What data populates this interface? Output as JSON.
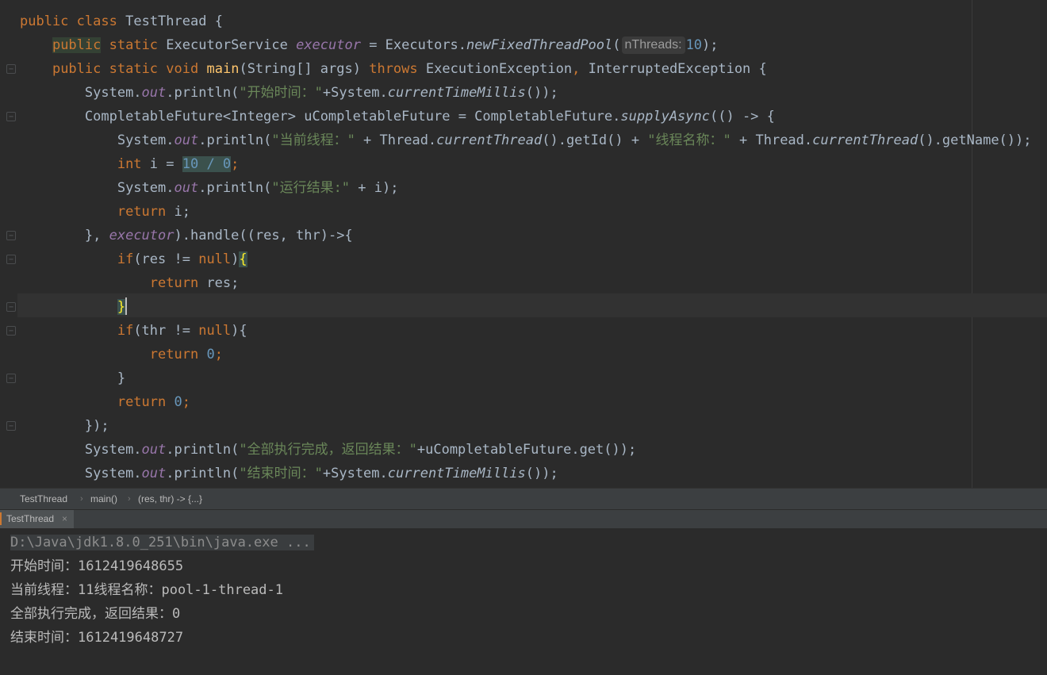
{
  "editor": {
    "lines": {
      "l1": {
        "kw_public": "public",
        "kw_class": "class",
        "name": "TestThread",
        "brace": " {"
      },
      "l2": {
        "kw_public": "public",
        "kw_static": "static",
        "type": "ExecutorService",
        "field": "executor",
        "eq": " = Executors.",
        "method": "newFixedThreadPool",
        "open": "(",
        "hint": "nThreads:",
        "num": "10",
        "close": ");"
      },
      "l3": {
        "kw_public": "public",
        "kw_static": "static",
        "kw_void": "void",
        "method": "main",
        "params": "(String[] args) ",
        "kw_throws": "throws",
        "exc1": " ExecutionException",
        "comma": ",",
        "exc2": " InterruptedException {"
      },
      "l4": {
        "sys": "System.",
        "out": "out",
        "println": ".println(",
        "str": "\"开始时间：\"",
        "plus": "+System.",
        "ctm": "currentTimeMillis",
        "end": "());"
      },
      "l5": {
        "type": "CompletableFuture<Integer> uCompletableFuture = CompletableFuture.",
        "method": "supplyAsync",
        "rest": "(() -> {"
      },
      "l6": {
        "sys": "System.",
        "out": "out",
        "println": ".println(",
        "str1": "\"当前线程：\"",
        "mid1": " + Thread.",
        "ct1": "currentThread",
        "mid2": "().getId() + ",
        "str2": "\"线程名称：\"",
        "mid3": " + Thread.",
        "ct2": "currentThread",
        "end": "().getName());"
      },
      "l7": {
        "kw_int": "int",
        "var": " i = ",
        "expr": "10 / 0",
        "semi": ";"
      },
      "l8": {
        "sys": "System.",
        "out": "out",
        "println": ".println(",
        "str": "\"运行结果:\"",
        "rest": " + i);"
      },
      "l9": {
        "kw_return": "return",
        "rest": " i;"
      },
      "l10": {
        "start": "}, ",
        "field": "executor",
        "rest": ").handle((res, thr)->{"
      },
      "l11": {
        "kw_if": "if",
        "cond": "(res != ",
        "kw_null": "null",
        "close": ")",
        "brace": "{"
      },
      "l12": {
        "kw_return": "return",
        "rest": " res;"
      },
      "l13": {
        "brace": "}"
      },
      "l14": {
        "kw_if": "if",
        "cond": "(thr != ",
        "kw_null": "null",
        "close": "){"
      },
      "l15": {
        "kw_return": "return",
        "num": "0",
        "semi": ";"
      },
      "l16": {
        "brace": "}"
      },
      "l17": {
        "kw_return": "return",
        "num": "0",
        "semi": ";"
      },
      "l18": {
        "text": "});"
      },
      "l19": {
        "sys": "System.",
        "out": "out",
        "println": ".println(",
        "str": "\"全部执行完成，返回结果：\"",
        "rest": "+uCompletableFuture.get());"
      },
      "l20": {
        "sys": "System.",
        "out": "out",
        "println": ".println(",
        "str": "\"结束时间：\"",
        "plus": "+System.",
        "ctm": "currentTimeMillis",
        "end": "());"
      }
    }
  },
  "breadcrumb": {
    "items": [
      "TestThread",
      "main()",
      "(res, thr) -> {...}"
    ],
    "separator": "›"
  },
  "run_panel": {
    "tab_label": "TestThread",
    "close_glyph": "×"
  },
  "console": {
    "command": "D:\\Java\\jdk1.8.0_251\\bin\\java.exe ...",
    "lines": [
      "开始时间：1612419648655",
      "当前线程：11线程名称：pool-1-thread-1",
      "全部执行完成，返回结果：0",
      "结束时间：1612419648727"
    ]
  },
  "colors": {
    "background": "#2b2b2b",
    "keyword": "#cc7832",
    "string": "#6a8759",
    "number": "#6897bb",
    "field": "#9876aa",
    "method": "#ffc66d",
    "text": "#a9b7c6"
  }
}
